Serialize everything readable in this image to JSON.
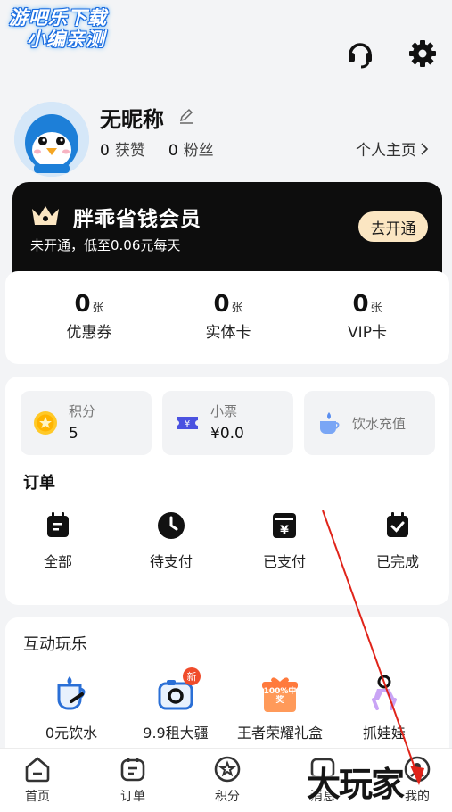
{
  "watermark": {
    "line1": "游吧乐下载",
    "line2": "小编亲测"
  },
  "profile": {
    "nickname": "无昵称",
    "likes_count": "0",
    "likes_label": "获赞",
    "fans_count": "0",
    "fans_label": "粉丝",
    "homepage_label": "个人主页"
  },
  "vip": {
    "title": "胖乖省钱会员",
    "subtitle": "未开通，低至0.06元每天",
    "button": "去开通"
  },
  "coupons": [
    {
      "num": "0",
      "unit": "张",
      "label": "优惠券"
    },
    {
      "num": "0",
      "unit": "张",
      "label": "实体卡"
    },
    {
      "num": "0",
      "unit": "张",
      "label": "VIP卡"
    }
  ],
  "wallet": {
    "points": {
      "label": "积分",
      "value": "5"
    },
    "tickets": {
      "label": "小票",
      "value": "¥0.0"
    },
    "water": {
      "label": "饮水充值"
    }
  },
  "orders": {
    "title": "订单",
    "items": [
      {
        "label": "全部",
        "icon": "calendar-icon"
      },
      {
        "label": "待支付",
        "icon": "clock-icon"
      },
      {
        "label": "已支付",
        "icon": "yen-wallet-icon"
      },
      {
        "label": "已完成",
        "icon": "check-calendar-icon"
      }
    ]
  },
  "fun": {
    "title": "互动玩乐",
    "items": [
      {
        "label": "0元饮水"
      },
      {
        "label": "9.9租大疆",
        "badge": "新"
      },
      {
        "label": "王者荣耀礼盒",
        "badge_text": "100%中奖"
      },
      {
        "label": "抓娃娃"
      }
    ]
  },
  "nav": [
    {
      "label": "首页"
    },
    {
      "label": "订单"
    },
    {
      "label": "积分"
    },
    {
      "label": "消息"
    },
    {
      "label": "我的"
    }
  ],
  "overlay_brand": "大玩家",
  "colors": {
    "vip_bg": "#0d0d0d",
    "vip_button": "#fbe6c2",
    "accent_orange": "#ff8a3d",
    "arrow": "#e0241a"
  }
}
